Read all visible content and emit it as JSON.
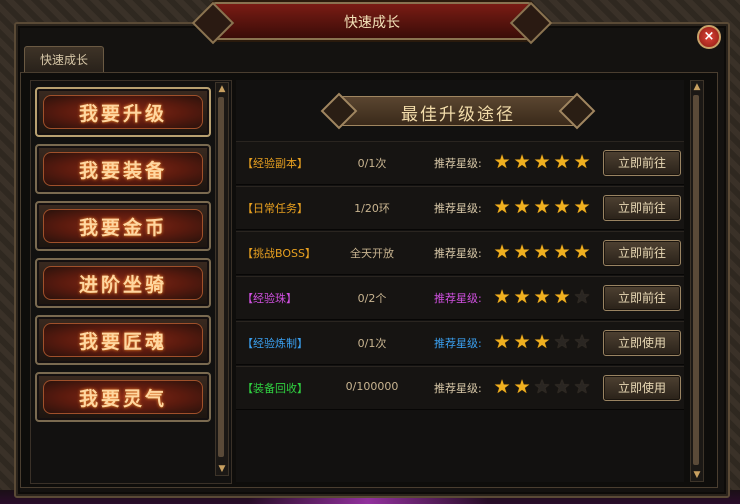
{
  "window": {
    "title": "快速成长",
    "close_label": "×"
  },
  "tab": {
    "label": "快速成长"
  },
  "menu": [
    {
      "label": "我要升级"
    },
    {
      "label": "我要装备"
    },
    {
      "label": "我要金币"
    },
    {
      "label": "进阶坐骑"
    },
    {
      "label": "我要匠魂"
    },
    {
      "label": "我要灵气"
    }
  ],
  "banner": {
    "title": "最佳升级途径"
  },
  "rows": [
    {
      "name": "【经验副本】",
      "name_color": "#e8a020",
      "count": "0/1次",
      "rec_label": "推荐星级:",
      "rec_color": "#d8c8a8",
      "stars": 5,
      "max_stars": 5,
      "button": "立即前往"
    },
    {
      "name": "【日常任务】",
      "name_color": "#e8a020",
      "count": "1/20环",
      "rec_label": "推荐星级:",
      "rec_color": "#d8c8a8",
      "stars": 5,
      "max_stars": 5,
      "button": "立即前往"
    },
    {
      "name": "【挑战BOSS】",
      "name_color": "#e8a020",
      "count": "全天开放",
      "rec_label": "推荐星级:",
      "rec_color": "#d8c8a8",
      "stars": 5,
      "max_stars": 5,
      "button": "立即前往"
    },
    {
      "name": "【经验珠】",
      "name_color": "#d050e0",
      "count": "0/2个",
      "rec_label": "推荐星级:",
      "rec_color": "#d050e0",
      "stars": 4,
      "max_stars": 5,
      "button": "立即前往"
    },
    {
      "name": "【经验炼制】",
      "name_color": "#3aa0f0",
      "count": "0/1次",
      "rec_label": "推荐星级:",
      "rec_color": "#3aa0f0",
      "stars": 3,
      "max_stars": 5,
      "button": "立即使用"
    },
    {
      "name": "【装备回收】",
      "name_color": "#30d040",
      "count": "0/100000",
      "rec_label": "推荐星级:",
      "rec_color": "#d8c8a8",
      "stars": 2,
      "max_stars": 5,
      "button": "立即使用"
    }
  ],
  "icons": {
    "star": "star-icon",
    "close": "close-icon",
    "scroll_up": "arrow-up-icon",
    "scroll_down": "arrow-down-icon"
  }
}
